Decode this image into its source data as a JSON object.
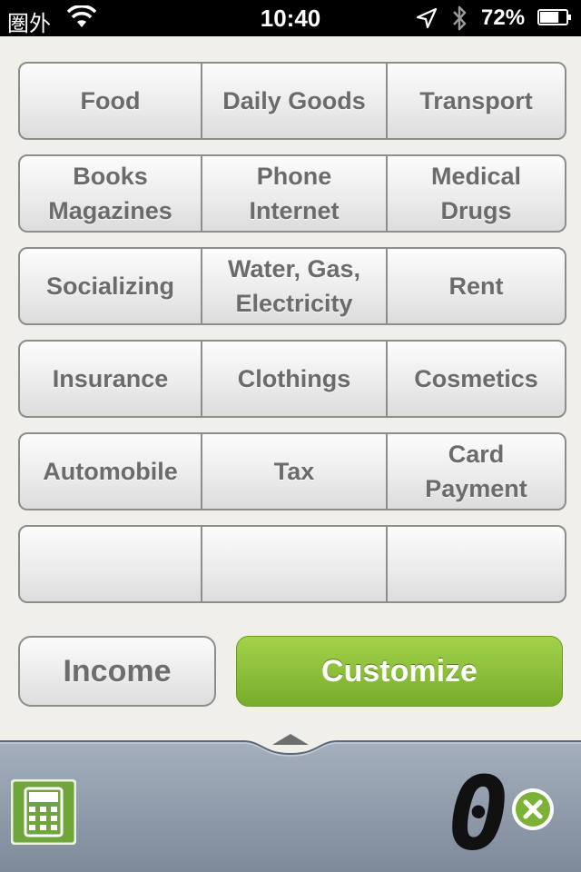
{
  "status_bar": {
    "carrier": "圏外",
    "time": "10:40",
    "battery_percent": "72%",
    "battery_level": 0.72,
    "icons": [
      "wifi-icon",
      "location-arrow-icon",
      "bluetooth-icon",
      "battery-icon"
    ]
  },
  "categories": {
    "rows": [
      [
        "Food",
        "Daily Goods",
        "Transport"
      ],
      [
        "Books\nMagazines",
        "Phone\nInternet",
        "Medical\nDrugs"
      ],
      [
        "Socializing",
        "Water, Gas,\nElectricity",
        "Rent"
      ],
      [
        "Insurance",
        "Clothings",
        "Cosmetics"
      ],
      [
        "Automobile",
        "Tax",
        "Card\nPayment"
      ],
      [
        "",
        "",
        ""
      ]
    ]
  },
  "buttons": {
    "income": "Income",
    "customize": "Customize"
  },
  "display": {
    "amount": "0",
    "calculator_icon": "calculator-icon",
    "clear_icon": "clear-x-icon"
  },
  "colors": {
    "accent_green": "#8cc63f",
    "bottom_bar": "#8c98a8",
    "background": "#f1efea",
    "label_gray": "#6b6b6b"
  }
}
